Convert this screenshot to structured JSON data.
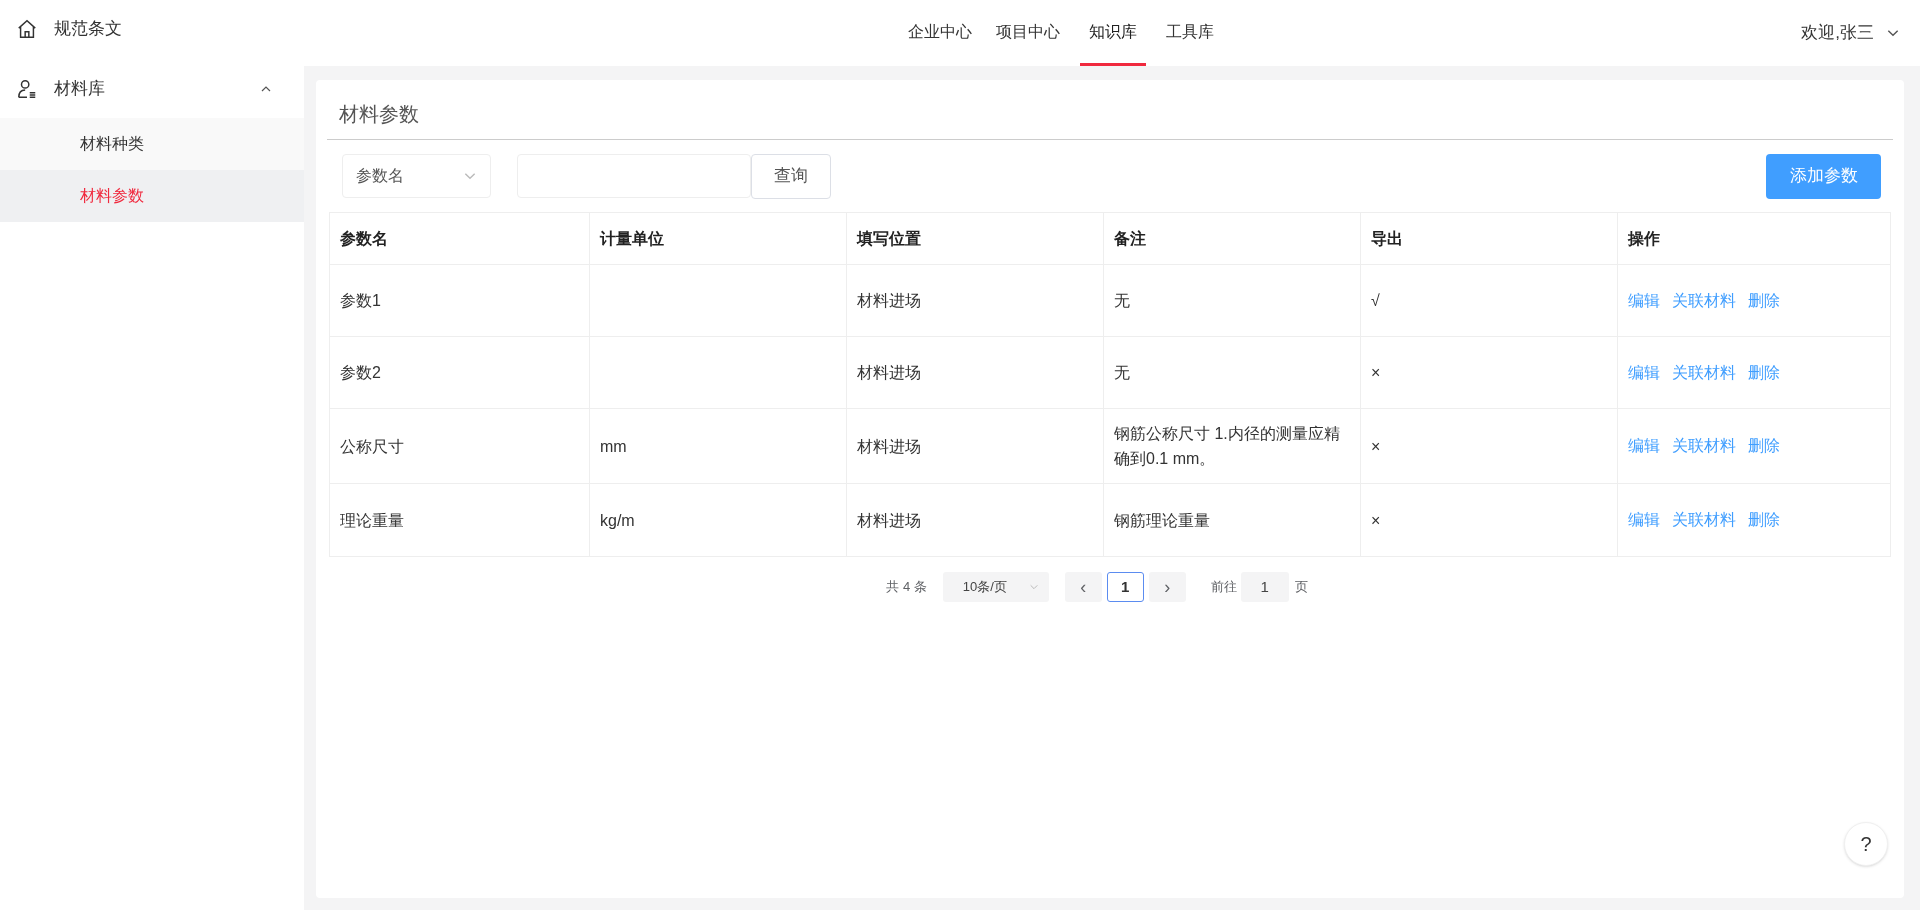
{
  "sidebar": {
    "items": [
      {
        "kind": "link",
        "label": "规范条文"
      },
      {
        "kind": "group",
        "label": "材料库",
        "expanded": true,
        "children": [
          {
            "label": "材料种类",
            "selected": false
          },
          {
            "label": "材料参数",
            "selected": true
          }
        ]
      }
    ]
  },
  "nav": {
    "tabs": [
      {
        "label": "企业中心",
        "selected": false
      },
      {
        "label": "项目中心",
        "selected": false
      },
      {
        "label": "知识库",
        "selected": true
      },
      {
        "label": "工具库",
        "selected": false
      }
    ],
    "user": "欢迎,张三"
  },
  "page_title": "材料参数",
  "filter": {
    "select_value": "参数名",
    "search_button": "查询",
    "add_button": "添加参数"
  },
  "table": {
    "columns": [
      "参数名",
      "计量单位",
      "填写位置",
      "备注",
      "导出",
      "操作"
    ],
    "rows": [
      {
        "cells": [
          "参数1",
          "",
          "材料进场",
          "无",
          "√"
        ],
        "actions": [
          "编辑",
          "关联材料",
          "删除"
        ]
      },
      {
        "cells": [
          "参数2",
          "",
          "材料进场",
          "无",
          "×"
        ],
        "actions": [
          "编辑",
          "关联材料",
          "删除"
        ]
      },
      {
        "cells": [
          "公称尺寸",
          "mm",
          "材料进场",
          "钢筋公称尺寸 1.内径的测量应精确到0.1 mm。",
          "×"
        ],
        "actions": [
          "编辑",
          "关联材料",
          "删除"
        ]
      },
      {
        "cells": [
          "理论重量",
          "kg/m",
          "材料进场",
          "钢筋理论重量",
          "×"
        ],
        "actions": [
          "编辑",
          "关联材料",
          "删除"
        ]
      }
    ]
  },
  "pagination": {
    "total": "共 4 条",
    "page_size": "10条/页",
    "prev": "‹",
    "page": "1",
    "next": "›",
    "goto_label": "前往",
    "goto_value": "1",
    "goto_suffix": "页"
  },
  "help_button": "?"
}
